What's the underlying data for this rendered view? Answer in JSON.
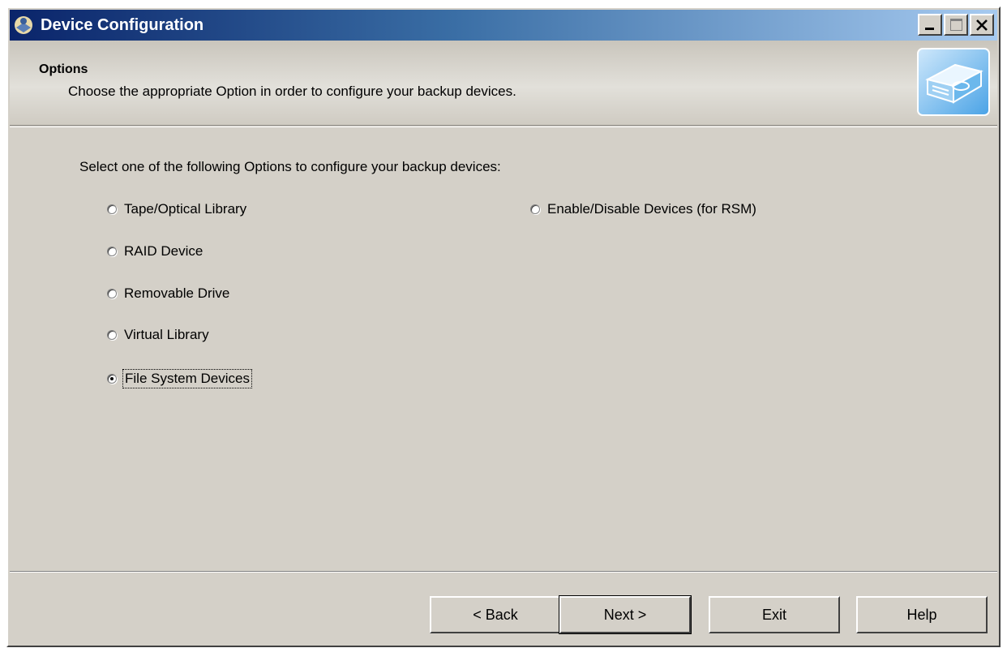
{
  "window": {
    "title": "Device Configuration"
  },
  "header": {
    "title": "Options",
    "subtitle": "Choose the appropriate Option in order to configure your backup devices.",
    "icon": "backup-device-icon"
  },
  "main": {
    "prompt": "Select one of the following Options to configure your backup devices:",
    "options_left": [
      {
        "label": "Tape/Optical Library",
        "checked": false
      },
      {
        "label": "RAID Device",
        "checked": false
      },
      {
        "label": "Removable Drive",
        "checked": false
      },
      {
        "label": "Virtual Library",
        "checked": false
      },
      {
        "label": "File System Devices",
        "checked": true
      }
    ],
    "options_right": [
      {
        "label": "Enable/Disable Devices (for RSM)",
        "checked": false
      }
    ]
  },
  "footer": {
    "back_label": "< Back",
    "next_label": "Next >",
    "exit_label": "Exit",
    "help_label": "Help"
  },
  "colors": {
    "titlebar_start": "#0a246a",
    "titlebar_end": "#a6caf0",
    "face": "#d4d0c8"
  }
}
